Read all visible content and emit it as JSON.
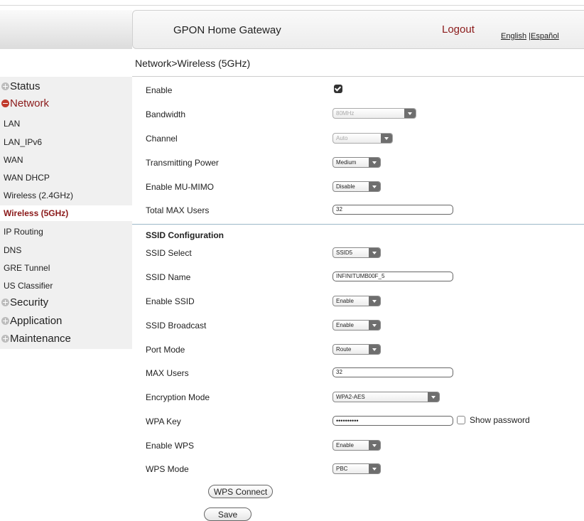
{
  "header": {
    "title": "GPON Home Gateway",
    "logout": "Logout",
    "lang_english": "English",
    "lang_sep": " |",
    "lang_espanol": "Español"
  },
  "breadcrumb": "Network>Wireless (5GHz)",
  "sidebar": {
    "status": "Status",
    "network": "Network",
    "items": [
      "LAN",
      "LAN_IPv6",
      "WAN",
      "WAN DHCP",
      "Wireless (2.4GHz)",
      "Wireless (5GHz)",
      "IP Routing",
      "DNS",
      "GRE Tunnel",
      "US Classifier"
    ],
    "security": "Security",
    "application": "Application",
    "maintenance": "Maintenance"
  },
  "form": {
    "enable_label": "Enable",
    "enable_checked": true,
    "bandwidth_label": "Bandwidth",
    "bandwidth_value": "80MHz",
    "channel_label": "Channel",
    "channel_value": "Auto",
    "tx_power_label": "Transmitting Power",
    "tx_power_value": "Medium",
    "mumimo_label": "Enable MU-MIMO",
    "mumimo_value": "Disable",
    "total_max_label": "Total MAX Users",
    "total_max_value": "32",
    "ssid_section": "SSID Configuration",
    "ssid_select_label": "SSID Select",
    "ssid_select_value": "SSID5",
    "ssid_name_label": "SSID Name",
    "ssid_name_value": "INFINITUMB00F_5",
    "enable_ssid_label": "Enable SSID",
    "enable_ssid_value": "Enable",
    "ssid_broadcast_label": "SSID Broadcast",
    "ssid_broadcast_value": "Enable",
    "port_mode_label": "Port Mode",
    "port_mode_value": "Route",
    "max_users_label": "MAX Users",
    "max_users_value": "32",
    "encryption_label": "Encryption Mode",
    "encryption_value": "WPA2-AES",
    "wpa_key_label": "WPA Key",
    "wpa_key_value": "••••••••••",
    "show_password": "Show password",
    "enable_wps_label": "Enable WPS",
    "enable_wps_value": "Enable",
    "wps_mode_label": "WPS Mode",
    "wps_mode_value": "PBC"
  },
  "buttons": {
    "wps_connect": "WPS Connect",
    "save": "Save"
  },
  "colors": {
    "accent": "#8b1a1a",
    "section_line": "#9db8c8"
  }
}
